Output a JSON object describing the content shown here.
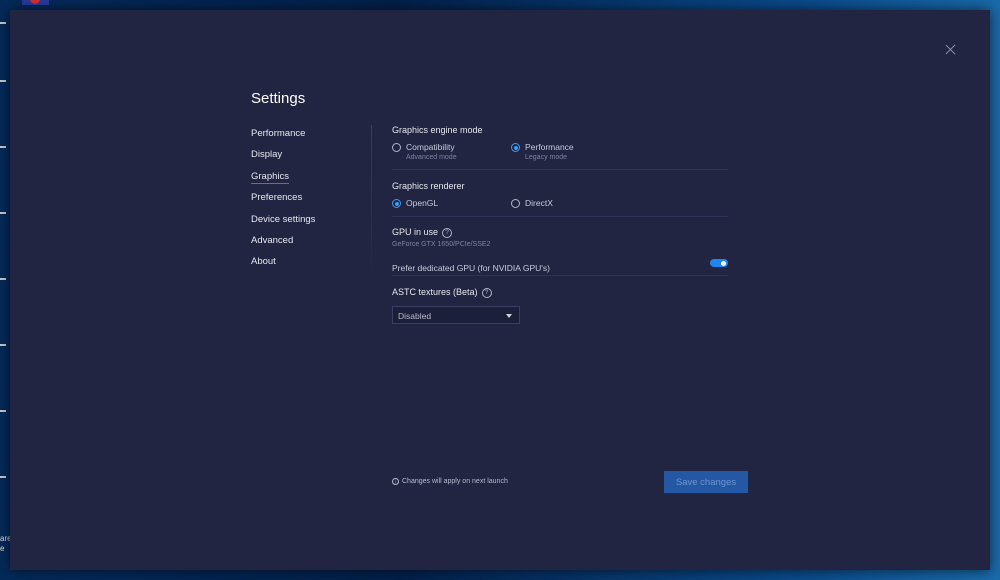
{
  "dialog": {
    "title": "Settings",
    "close_icon": "close-icon"
  },
  "nav": {
    "items": [
      {
        "label": "Performance",
        "active": false
      },
      {
        "label": "Display",
        "active": false
      },
      {
        "label": "Graphics",
        "active": true
      },
      {
        "label": "Preferences",
        "active": false
      },
      {
        "label": "Device settings",
        "active": false
      },
      {
        "label": "Advanced",
        "active": false
      },
      {
        "label": "About",
        "active": false
      }
    ]
  },
  "graphics": {
    "engine_mode": {
      "label": "Graphics engine mode",
      "options": [
        {
          "label": "Compatibility",
          "sublabel": "Advanced mode",
          "checked": false
        },
        {
          "label": "Performance",
          "sublabel": "Legacy mode",
          "checked": true
        }
      ]
    },
    "renderer": {
      "label": "Graphics renderer",
      "options": [
        {
          "label": "OpenGL",
          "checked": true
        },
        {
          "label": "DirectX",
          "checked": false
        }
      ]
    },
    "gpu": {
      "label": "GPU in use",
      "help_icon": "?",
      "name": "GeForce GTX 1650/PCIe/SSE2",
      "prefer_dedicated_label": "Prefer dedicated GPU (for NVIDIA GPU's)",
      "prefer_dedicated_enabled": true
    },
    "astc": {
      "label": "ASTC textures (Beta)",
      "help_icon": "?",
      "selected": "Disabled"
    }
  },
  "footer": {
    "info_icon": "i",
    "note": "Changes will apply on next launch",
    "save_label": "Save changes"
  },
  "desktop": {
    "partial_labels": [
      "are",
      "e"
    ]
  },
  "colors": {
    "accent": "#3a9bf5",
    "toggle_on": "#1f86f0",
    "save_button": "#2458a4",
    "dialog_bg": "#222542"
  }
}
